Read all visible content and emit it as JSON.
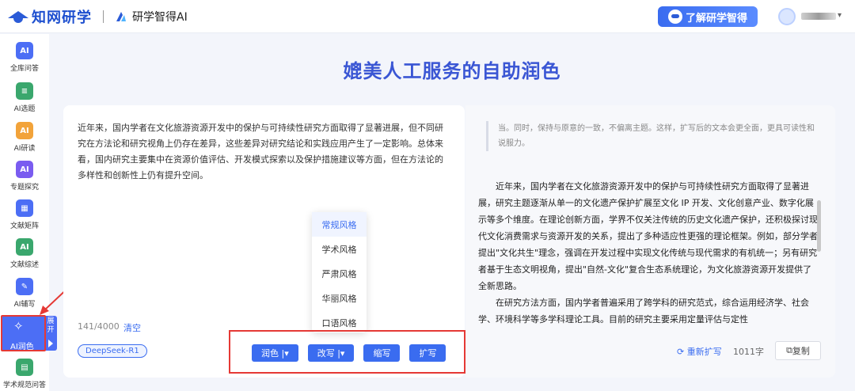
{
  "header": {
    "brand": "知网研学",
    "product": "研学智得AI",
    "learn_button": "了解研学智得",
    "accent": "#2b5bd7"
  },
  "sidebar": {
    "items": [
      {
        "label": "全库问答",
        "icon": "AI",
        "color": "#4c6ef5"
      },
      {
        "label": "AI选题",
        "icon": "≡",
        "color": "#3aa76d"
      },
      {
        "label": "AI研读",
        "icon": "AI",
        "color": "#f2a33a"
      },
      {
        "label": "专题探究",
        "icon": "AI",
        "color": "#7a5cf0"
      },
      {
        "label": "文献矩阵",
        "icon": "▦",
        "color": "#4c6ef5"
      },
      {
        "label": "文献综述",
        "icon": "AI",
        "color": "#3aa76d"
      },
      {
        "label": "AI辅写",
        "icon": "✎",
        "color": "#4c6ef5"
      },
      {
        "label": "学术规范问答",
        "icon": "▤",
        "color": "#3aa76d"
      }
    ],
    "active": {
      "label": "AI润色",
      "icon": "✧",
      "expand": "展开"
    }
  },
  "page_title": "媲美人工服务的自助润色",
  "input": {
    "text": "近年来，国内学者在文化旅游资源开发中的保护与可持续性研究方面取得了显著进展，但不同研究在方法论和研究视角上仍存在差异，这些差异对研究结论和实践应用产生了一定影响。总体来看，国内研究主要集中在资源价值评估、开发模式探索以及保护措施建议等方面，但在方法论的多样性和创新性上仍有提升空间。",
    "counter": "141/4000",
    "clear": "清空",
    "model": "DeepSeek-R1"
  },
  "actions": [
    {
      "label": "润色 |▾"
    },
    {
      "label": "改写 |▾"
    },
    {
      "label": "缩写"
    },
    {
      "label": "扩写"
    }
  ],
  "style_dropdown": {
    "options": [
      "常规风格",
      "学术风格",
      "严肃风格",
      "华丽风格",
      "口语风格"
    ],
    "selected": "常规风格"
  },
  "output": {
    "quote": "当。同时，保持与原意的一致，不偏离主题。这样，扩写后的文本会更全面，更具可读性和说服力。",
    "paragraphs": [
      "近年来，国内学者在文化旅游资源开发中的保护与可持续性研究方面取得了显著进展，研究主题逐渐从单一的文化遗产保护扩展至文化 IP 开发、文化创意产业、数字化展示等多个维度。在理论创新方面，学界不仅关注传统的历史文化遗产保护，还积极探讨现代文化消费需求与资源开发的关系，提出了多种适应性更强的理论框架。例如，部分学者提出\"文化共生\"理念，强调在开发过程中实现文化传统与现代需求的有机统一；另有研究者基于生态文明视角，提出\"自然-文化\"复合生态系统理论，为文化旅游资源开发提供了全新思路。",
      "在研究方法方面，国内学者普遍采用了跨学科的研究范式，综合运用经济学、社会学、环境科学等多学科理论工具。目前的研究主要采用定量评估与定性"
    ],
    "regenerate": "重新扩写",
    "word_count": "1011字",
    "copy": "复制"
  }
}
